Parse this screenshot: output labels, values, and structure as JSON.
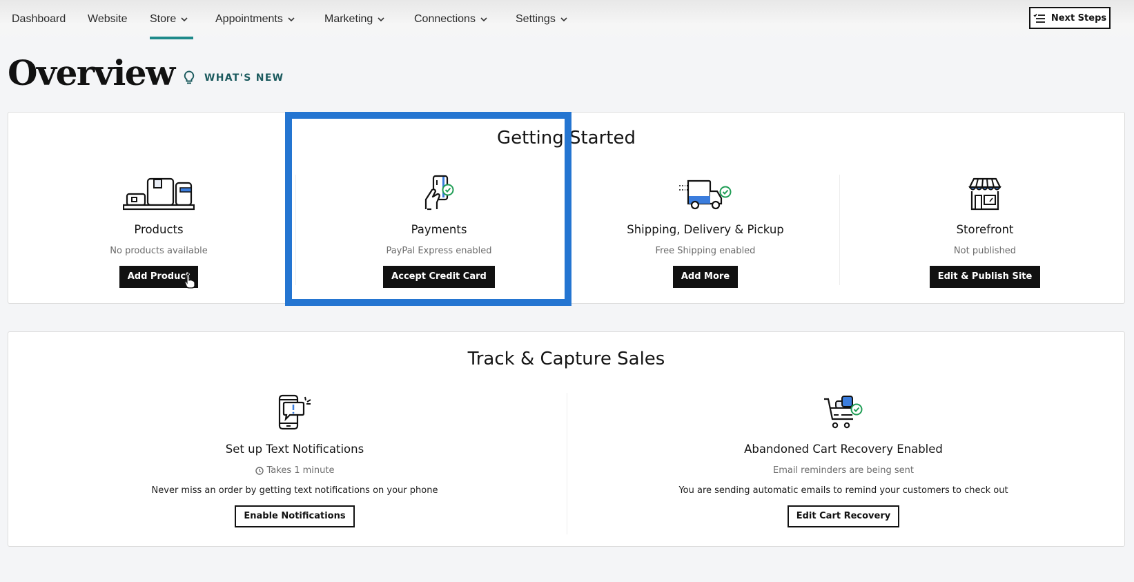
{
  "nav": {
    "items": [
      {
        "label": "Dashboard",
        "has_dropdown": false
      },
      {
        "label": "Website",
        "has_dropdown": false
      },
      {
        "label": "Store",
        "has_dropdown": true,
        "active": true
      },
      {
        "label": "Appointments",
        "has_dropdown": true
      },
      {
        "label": "Marketing",
        "has_dropdown": true
      },
      {
        "label": "Connections",
        "has_dropdown": true
      },
      {
        "label": "Settings",
        "has_dropdown": true
      }
    ],
    "next_steps_label": "Next Steps",
    "active_color": "#1e8a8a"
  },
  "page": {
    "title": "Overview",
    "whats_new": "WHAT'S NEW"
  },
  "getting_started": {
    "title": "Getting Started",
    "items": [
      {
        "icon": "products-icon",
        "name": "Products",
        "status": "No products available",
        "button": "Add Product"
      },
      {
        "icon": "payments-icon",
        "name": "Payments",
        "status": "PayPal Express enabled",
        "button": "Accept Credit Card"
      },
      {
        "icon": "shipping-truck-icon",
        "name": "Shipping, Delivery & Pickup",
        "status": "Free Shipping enabled",
        "button": "Add More"
      },
      {
        "icon": "storefront-icon",
        "name": "Storefront",
        "status": "Not published",
        "button": "Edit & Publish Site"
      }
    ]
  },
  "track_capture": {
    "title": "Track & Capture Sales",
    "items": [
      {
        "icon": "phone-notification-icon",
        "name": "Set up Text Notifications",
        "status": "Takes 1 minute",
        "status_icon": "clock-icon",
        "description": "Never miss an order by getting text notifications on your phone",
        "button": "Enable Notifications"
      },
      {
        "icon": "cart-check-icon",
        "name": "Abandoned Cart Recovery Enabled",
        "status": "Email reminders are being sent",
        "description": "You are sending automatic emails to remind your customers to check out",
        "button": "Edit Cart Recovery"
      }
    ]
  },
  "colors": {
    "highlight": "#2475d1",
    "accent_blue": "#3b7ddd",
    "success_green": "#1f9d55",
    "teal_text": "#1b5a5e"
  }
}
